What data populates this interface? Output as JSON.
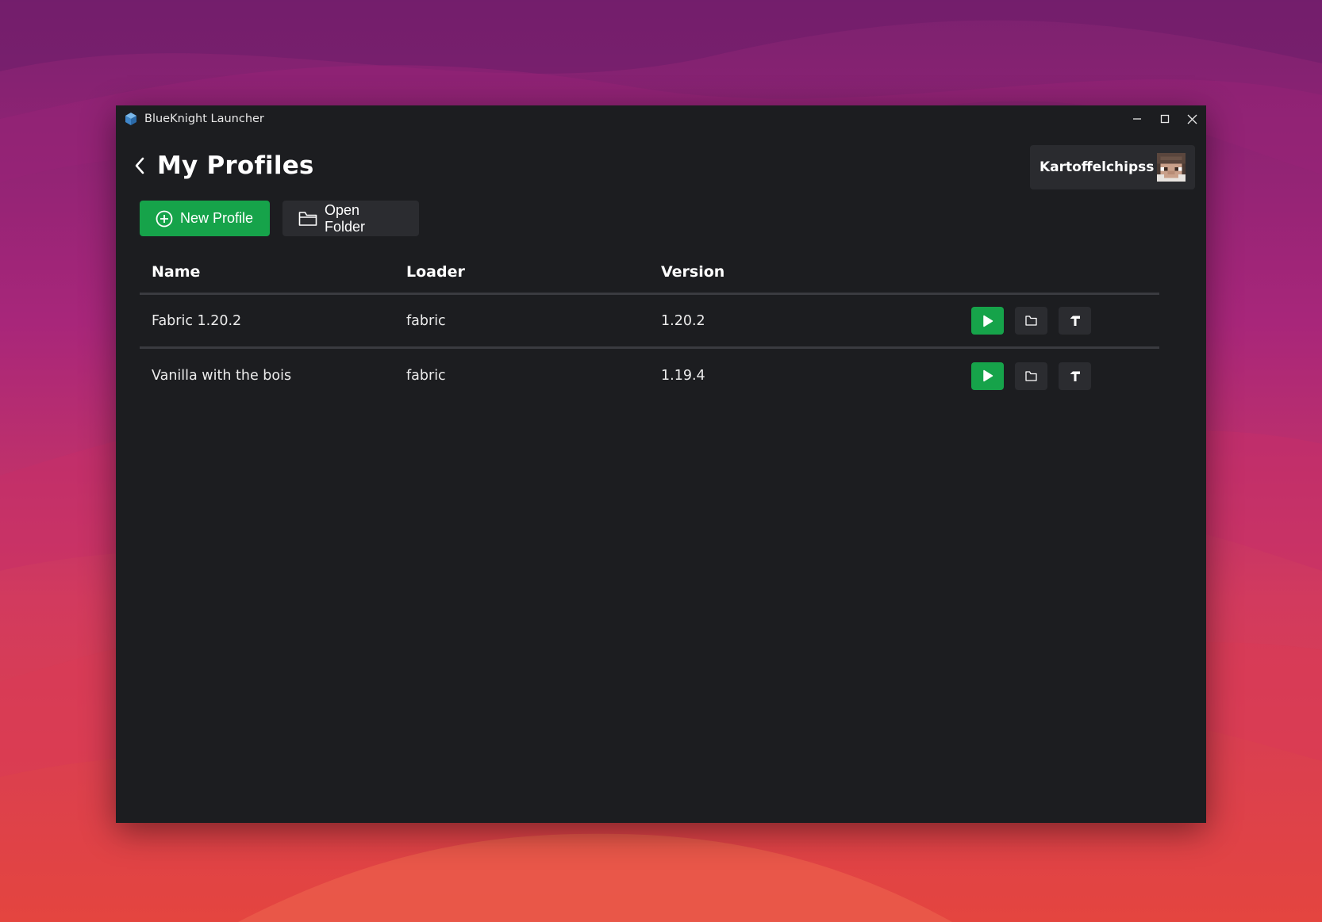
{
  "window": {
    "title": "BlueKnight Launcher",
    "app_icon": "cube-icon"
  },
  "header": {
    "title": "My Profiles",
    "back_icon": "chevron-left-icon"
  },
  "user": {
    "name": "Kartoffelchipss",
    "avatar": "player-head-avatar"
  },
  "toolbar": {
    "new_profile_label": "New Profile",
    "open_folder_label": "Open Folder"
  },
  "table": {
    "columns": [
      "Name",
      "Loader",
      "Version"
    ],
    "rows": [
      {
        "name": "Fabric 1.20.2",
        "loader": "fabric",
        "version": "1.20.2"
      },
      {
        "name": "Vanilla with the bois",
        "loader": "fabric",
        "version": "1.19.4"
      }
    ],
    "row_actions": [
      "play-icon",
      "folder-icon",
      "hammer-icon"
    ]
  },
  "colors": {
    "accent": "#16a34a",
    "window_bg": "#1c1d20",
    "button_bg": "#2b2c30"
  }
}
